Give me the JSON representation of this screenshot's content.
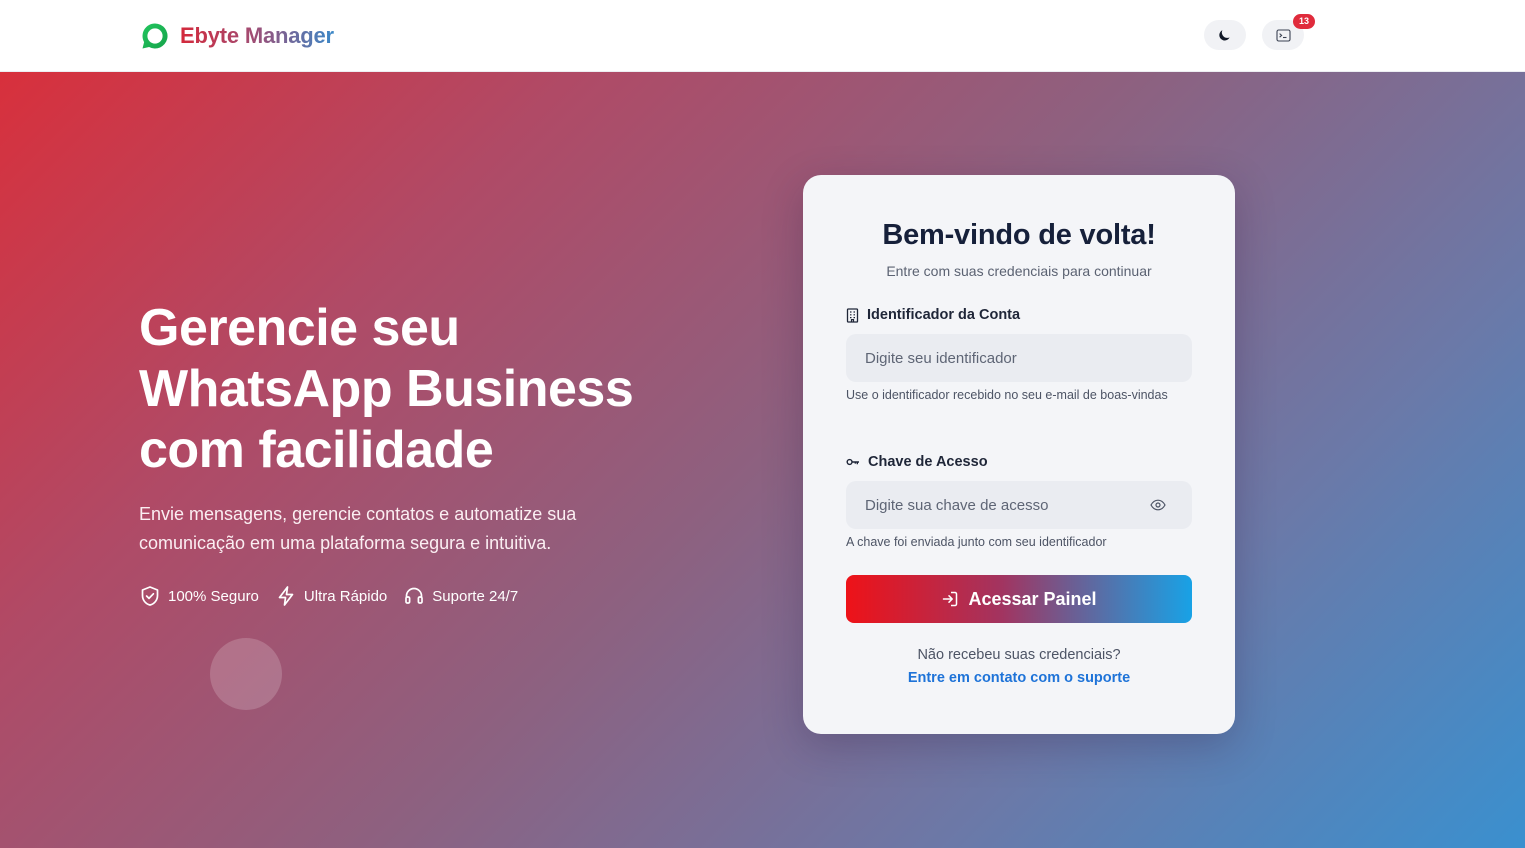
{
  "header": {
    "brand_name": "Ebyte Manager",
    "brand_icon": "chat-bubble-icon",
    "theme_toggle_icon": "moon-icon",
    "console_icon": "terminal-icon",
    "notification_count": "13"
  },
  "hero": {
    "title": "Gerencie seu WhatsApp Business com facilidade",
    "subtitle": "Envie mensagens, gerencie contatos e automatize sua comunicação em uma plataforma segura e intuitiva.",
    "features": [
      {
        "icon": "shield-check-icon",
        "label": "100% Seguro"
      },
      {
        "icon": "lightning-icon",
        "label": "Ultra Rápido"
      },
      {
        "icon": "headset-icon",
        "label": "Suporte 24/7"
      }
    ]
  },
  "login": {
    "title": "Bem-vindo de volta!",
    "subtitle": "Entre com suas credenciais para continuar",
    "account_id": {
      "label": "Identificador da Conta",
      "icon": "building-icon",
      "placeholder": "Digite seu identificador",
      "value": "",
      "hint": "Use o identificador recebido no seu e-mail de boas-vindas"
    },
    "access_key": {
      "label": "Chave de Acesso",
      "icon": "key-icon",
      "placeholder": "Digite sua chave de acesso",
      "value": "",
      "hint": "A chave foi enviada junto com seu identificador"
    },
    "submit_label": "Acessar Painel",
    "help_text": "Não recebeu suas credenciais?",
    "help_link": "Entre em contato com o suporte"
  },
  "colors": {
    "brand_red": "#d8303c",
    "brand_blue": "#3a90cf",
    "link": "#1e73d8",
    "badge": "#e02b3c"
  }
}
